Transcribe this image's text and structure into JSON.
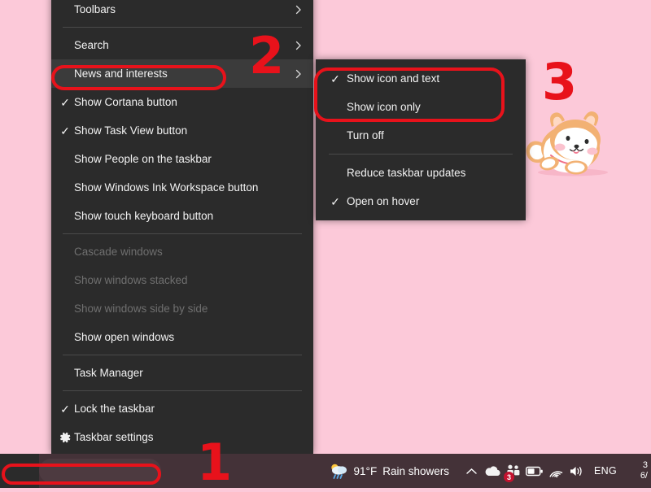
{
  "desktop": {
    "background_color": "#fcc9d9",
    "wallpaper_subject": "shiba-inu-dog"
  },
  "context_menu": {
    "name": "taskbar-context-menu",
    "items": [
      {
        "label": "Toolbars",
        "checked": false,
        "disabled": false,
        "submenu": true,
        "highlighted": false,
        "icon": "",
        "separator_after": true
      },
      {
        "label": "Search",
        "checked": false,
        "disabled": false,
        "submenu": true,
        "highlighted": false,
        "icon": "",
        "separator_after": false
      },
      {
        "label": "News and interests",
        "checked": false,
        "disabled": false,
        "submenu": true,
        "highlighted": true,
        "icon": "",
        "separator_after": false
      },
      {
        "label": "Show Cortana button",
        "checked": true,
        "disabled": false,
        "submenu": false,
        "highlighted": false,
        "icon": "",
        "separator_after": false
      },
      {
        "label": "Show Task View button",
        "checked": true,
        "disabled": false,
        "submenu": false,
        "highlighted": false,
        "icon": "",
        "separator_after": false
      },
      {
        "label": "Show People on the taskbar",
        "checked": false,
        "disabled": false,
        "submenu": false,
        "highlighted": false,
        "icon": "",
        "separator_after": false
      },
      {
        "label": "Show Windows Ink Workspace button",
        "checked": false,
        "disabled": false,
        "submenu": false,
        "highlighted": false,
        "icon": "",
        "separator_after": false
      },
      {
        "label": "Show touch keyboard button",
        "checked": false,
        "disabled": false,
        "submenu": false,
        "highlighted": false,
        "icon": "",
        "separator_after": true
      },
      {
        "label": "Cascade windows",
        "checked": false,
        "disabled": true,
        "submenu": false,
        "highlighted": false,
        "icon": "",
        "separator_after": false
      },
      {
        "label": "Show windows stacked",
        "checked": false,
        "disabled": true,
        "submenu": false,
        "highlighted": false,
        "icon": "",
        "separator_after": false
      },
      {
        "label": "Show windows side by side",
        "checked": false,
        "disabled": true,
        "submenu": false,
        "highlighted": false,
        "icon": "",
        "separator_after": false
      },
      {
        "label": "Show open windows",
        "checked": false,
        "disabled": false,
        "submenu": false,
        "highlighted": false,
        "icon": "",
        "separator_after": true
      },
      {
        "label": "Task Manager",
        "checked": false,
        "disabled": false,
        "submenu": false,
        "highlighted": false,
        "icon": "",
        "separator_after": true
      },
      {
        "label": "Lock the taskbar",
        "checked": true,
        "disabled": false,
        "submenu": false,
        "highlighted": false,
        "icon": "",
        "separator_after": false
      },
      {
        "label": "Taskbar settings",
        "checked": false,
        "disabled": false,
        "submenu": false,
        "highlighted": false,
        "icon": "gear-icon",
        "separator_after": false
      }
    ]
  },
  "submenu": {
    "name": "news-and-interests-submenu",
    "items": [
      {
        "label": "Show icon and text",
        "checked": true,
        "separator_after": false
      },
      {
        "label": "Show icon only",
        "checked": false,
        "separator_after": false
      },
      {
        "label": "Turn off",
        "checked": false,
        "separator_after": true
      },
      {
        "label": "Reduce taskbar updates",
        "checked": false,
        "separator_after": false
      },
      {
        "label": "Open on hover",
        "checked": true,
        "separator_after": false
      }
    ]
  },
  "taskbar": {
    "background_color": "#443238",
    "weather": {
      "icon": "rain-cloud-sun-icon",
      "temperature": "91°F",
      "condition": "Rain showers"
    },
    "tray_icons": [
      {
        "name": "show-hidden-icons-chevron-icon",
        "glyph": "⌃"
      },
      {
        "name": "onedrive-icon",
        "glyph": ""
      },
      {
        "name": "microsoft-teams-icon",
        "badge": "3"
      },
      {
        "name": "battery-icon",
        "glyph": ""
      },
      {
        "name": "wifi-icon",
        "glyph": ""
      },
      {
        "name": "volume-icon",
        "glyph": ""
      }
    ],
    "language": "ENG",
    "clock": {
      "time": "3",
      "date": "6/"
    }
  },
  "annotations": {
    "color": "#e8121b",
    "numbers": [
      {
        "id": "1",
        "label": "1"
      },
      {
        "id": "2",
        "label": "2"
      },
      {
        "id": "3",
        "label": "3"
      }
    ],
    "boxes": [
      {
        "id": "news-and-interests-highlight"
      },
      {
        "id": "submenu-options-highlight"
      },
      {
        "id": "taskbar-search-highlight"
      }
    ]
  }
}
